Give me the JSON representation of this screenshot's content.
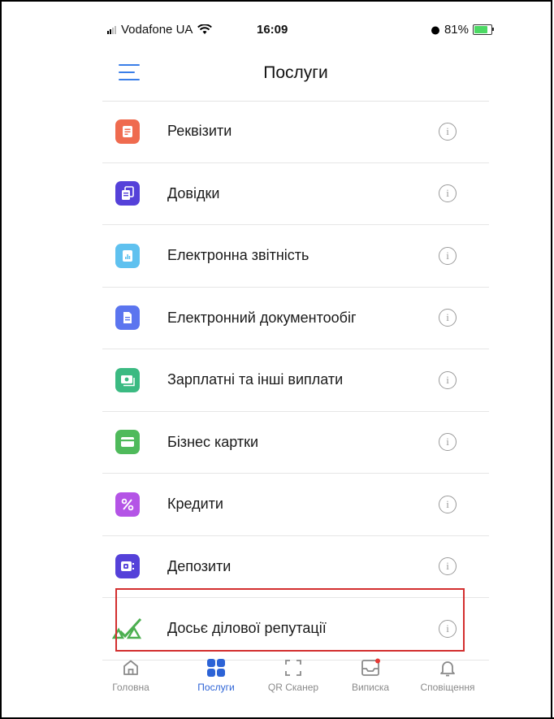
{
  "status_bar": {
    "carrier": "Vodafone UA",
    "time": "16:09",
    "battery": "81%"
  },
  "header": {
    "title": "Послуги"
  },
  "services": [
    {
      "label": "Реквізити",
      "icon": "document-icon",
      "color": "#ef6b4f"
    },
    {
      "label": "Довідки",
      "icon": "documents-stack-icon",
      "color": "#5541d9"
    },
    {
      "label": "Електронна звітність",
      "icon": "report-chart-icon",
      "color": "#5fc1ef"
    },
    {
      "label": "Електронний документообіг",
      "icon": "file-icon",
      "color": "#5b75ef"
    },
    {
      "label": "Зарплатні та інші виплати",
      "icon": "payroll-icon",
      "color": "#3bba82"
    },
    {
      "label": "Бізнес картки",
      "icon": "card-icon",
      "color": "#4fba5b"
    },
    {
      "label": "Кредити",
      "icon": "percent-icon",
      "color": "#b454e6"
    },
    {
      "label": "Депозити",
      "icon": "safe-icon",
      "color": "#5541d9"
    },
    {
      "label": "Досьє ділової репутації",
      "icon": "reputation-check-icon",
      "color": "#4caf50"
    }
  ],
  "tabs": [
    {
      "label": "Головна",
      "icon": "home-icon",
      "active": false
    },
    {
      "label": "Послуги",
      "icon": "grid-icon",
      "active": true
    },
    {
      "label": "QR Сканер",
      "icon": "scan-icon",
      "active": false
    },
    {
      "label": "Виписка",
      "icon": "inbox-icon",
      "active": false
    },
    {
      "label": "Сповіщення",
      "icon": "bell-icon",
      "active": false
    }
  ],
  "colors": {
    "accent": "#2c63d6",
    "highlight": "#d32f2f",
    "notification_dot": "#e53935"
  }
}
